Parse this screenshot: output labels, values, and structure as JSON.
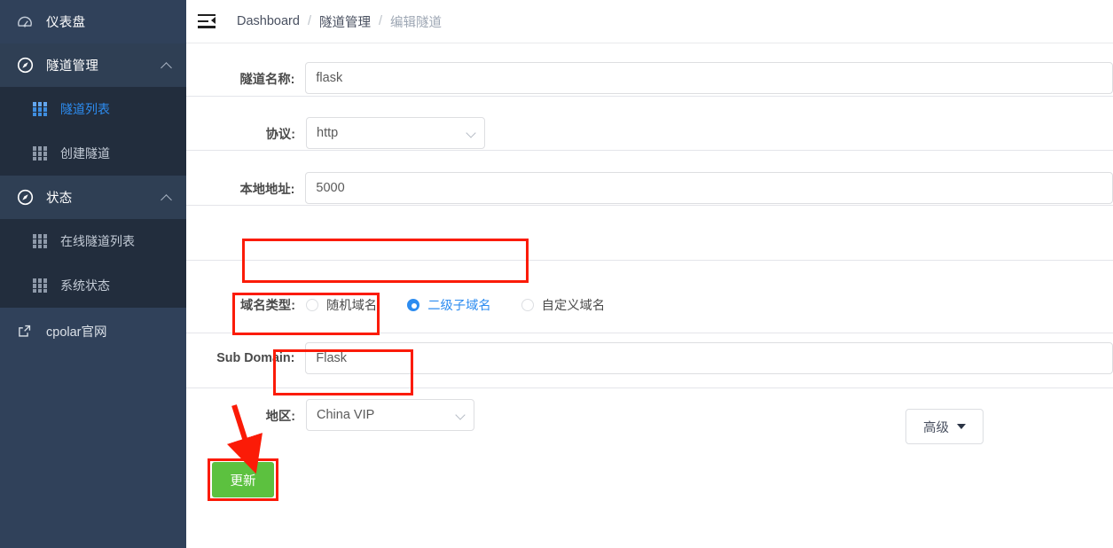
{
  "sidebar": {
    "items": [
      {
        "label": "仪表盘",
        "icon": "dashboard-icon",
        "type": "link"
      },
      {
        "label": "隧道管理",
        "icon": "compass-icon",
        "type": "group",
        "expanded": true,
        "children": [
          {
            "label": "隧道列表",
            "icon": "table-icon",
            "active": true
          },
          {
            "label": "创建隧道",
            "icon": "table-icon",
            "active": false
          }
        ]
      },
      {
        "label": "状态",
        "icon": "compass-icon",
        "type": "group",
        "expanded": true,
        "children": [
          {
            "label": "在线隧道列表",
            "icon": "table-icon",
            "active": false
          },
          {
            "label": "系统状态",
            "icon": "table-icon",
            "active": false
          }
        ]
      },
      {
        "label": "cpolar官网",
        "icon": "external-link-icon",
        "type": "external"
      }
    ]
  },
  "topbar": {
    "menu_toggle_icon": "menu-fold-icon",
    "breadcrumb": [
      {
        "label": "Dashboard",
        "current": false
      },
      {
        "label": "隧道管理",
        "current": false
      },
      {
        "label": "编辑隧道",
        "current": true
      }
    ],
    "separator": "/"
  },
  "form": {
    "tunnel_name": {
      "label": "隧道名称:",
      "value": "flask",
      "placeholder": ""
    },
    "protocol": {
      "label": "协议:",
      "value": "http",
      "icon": "chevron-down-icon"
    },
    "local_addr": {
      "label": "本地地址:",
      "value": "5000",
      "placeholder": ""
    },
    "domain_type": {
      "label": "域名类型:",
      "options": [
        {
          "label": "随机域名",
          "selected": false
        },
        {
          "label": "二级子域名",
          "selected": true
        },
        {
          "label": "自定义域名",
          "selected": false
        }
      ]
    },
    "sub_domain": {
      "label": "Sub Domain:",
      "value": "Flask",
      "placeholder": ""
    },
    "region": {
      "label": "地区:",
      "value": "China VIP",
      "icon": "chevron-down-icon"
    },
    "advanced_button": {
      "label": "高级",
      "icon": "caret-down-icon"
    },
    "submit_button": {
      "label": "更新"
    }
  },
  "annotations": {
    "highlight_color": "#fb1b07",
    "arrow_color": "#fb1b07",
    "boxes": [
      "domain-type-row",
      "sub-domain-row",
      "region-row",
      "submit-button"
    ],
    "arrow": "points-to-submit-button"
  },
  "colors": {
    "sidebar_bg": "#30415a",
    "sidebar_submenu_bg": "#222d3d",
    "accent_blue": "#2d8cf0",
    "submit_green": "#5cc13f",
    "annotation_red": "#fb1b07"
  }
}
